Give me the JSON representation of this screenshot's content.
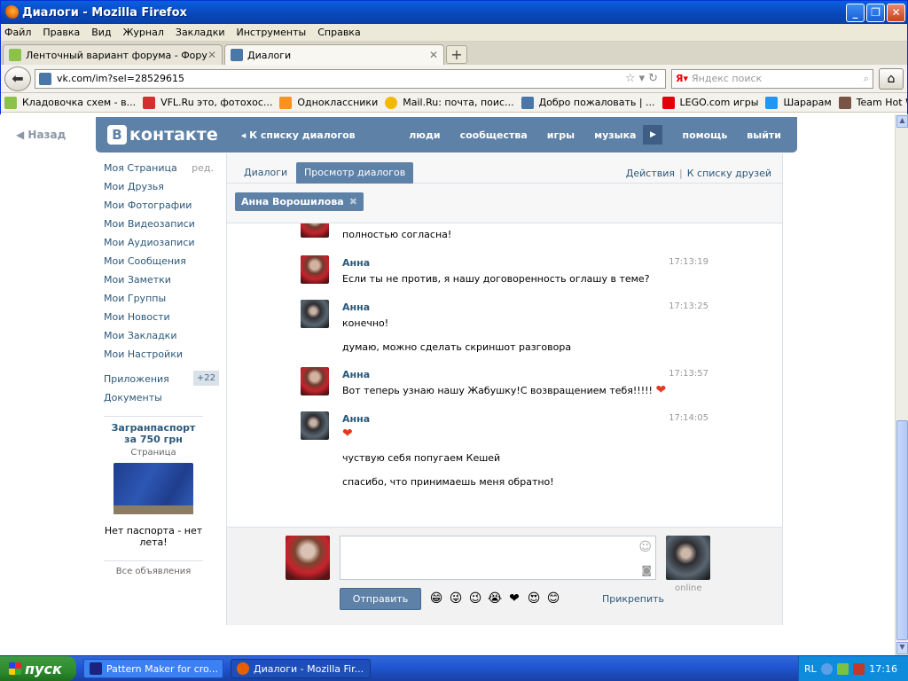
{
  "window": {
    "title": "Диалоги - Mozilla Firefox"
  },
  "menu": [
    "Файл",
    "Правка",
    "Вид",
    "Журнал",
    "Закладки",
    "Инструменты",
    "Справка"
  ],
  "tabs": [
    {
      "label": "Ленточный вариант форума - Форум",
      "active": false
    },
    {
      "label": "Диалоги",
      "active": true
    }
  ],
  "url": "vk.com/im?sel=28529615",
  "search": {
    "placeholder": "Яндекс поиск"
  },
  "bookmarks": [
    "Кладовочка схем - в...",
    "VFL.Ru это, фотохос...",
    "Одноклассники",
    "Mail.Ru: почта, поис...",
    "Добро пожаловать | ...",
    "LEGO.com игры",
    "Шарарам",
    "Team Hot Wheels: Mo..."
  ],
  "back_link": "Назад",
  "vk": {
    "logo": "контакте",
    "to_list": "К списку диалогов",
    "nav": [
      "люди",
      "сообщества",
      "игры",
      "музыка",
      "помощь",
      "выйти"
    ]
  },
  "left_menu": {
    "edit": "ред.",
    "items": [
      "Моя Страница",
      "Мои Друзья",
      "Мои Фотографии",
      "Мои Видеозаписи",
      "Мои Аудиозаписи",
      "Мои Сообщения",
      "Мои Заметки",
      "Мои Группы",
      "Мои Новости",
      "Мои Закладки",
      "Мои Настройки"
    ],
    "apps": "Приложения",
    "apps_count": "+22",
    "docs": "Документы"
  },
  "ad": {
    "title": "Загранпаспорт за 750 грн",
    "sub": "Страница",
    "text": "Нет паспорта - нет лета!",
    "all": "Все объявления"
  },
  "panel": {
    "tab1": "Диалоги",
    "tab2": "Просмотр диалогов",
    "actions": "Действия",
    "friends": "К списку друзей",
    "chip": "Анна Ворошилова"
  },
  "messages": [
    {
      "name": "Анна",
      "time": "",
      "lines": [
        "полностью согласна!"
      ]
    },
    {
      "name": "Анна",
      "time": "17:13:19",
      "lines": [
        "Если ты не против, я нашу договоренность оглашу в теме?"
      ]
    },
    {
      "name": "Анна",
      "time": "17:13:25",
      "lines": [
        "конечно!",
        "думаю, можно сделать скриншот разговора"
      ]
    },
    {
      "name": "Анна",
      "time": "17:13:57",
      "lines": [
        "Вот теперь узнаю нашу Жабушку!С возвращением тебя!!!!!"
      ]
    },
    {
      "name": "Анна",
      "time": "17:14:05",
      "lines": [
        "чуствую себя попугаем Кешей",
        "спасибо, что принимаешь меня обратно!"
      ]
    }
  ],
  "compose": {
    "send": "Отправить",
    "attach": "Прикрепить",
    "online": "online"
  },
  "taskbar": {
    "start": "пуск",
    "tasks": [
      "Pattern Maker for cro...",
      "Диалоги - Mozilla Fir..."
    ],
    "lang": "RL",
    "clock": "17:16"
  }
}
